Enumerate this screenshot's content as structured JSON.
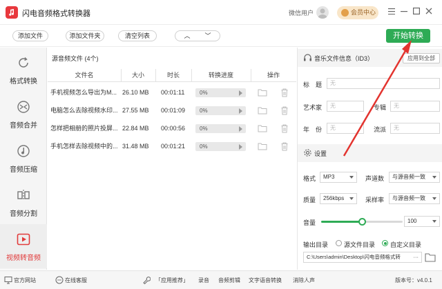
{
  "app": {
    "title": "闪电音频格式转换器"
  },
  "user": {
    "label": "微信用户",
    "vip_label": "会员中心"
  },
  "toolbar": {
    "add_file": "添加文件",
    "add_folder": "添加文件夹",
    "clear_list": "清空列表",
    "move_up": "︿",
    "move_down": "﹀",
    "start": "开始转换"
  },
  "sidebar": {
    "items": [
      {
        "label": "格式转换",
        "icon": "refresh-icon"
      },
      {
        "label": "音频合并",
        "icon": "merge-icon"
      },
      {
        "label": "音频压缩",
        "icon": "compress-icon"
      },
      {
        "label": "音频分割",
        "icon": "split-icon"
      },
      {
        "label": "视频转音频",
        "icon": "video-icon",
        "active": true
      }
    ]
  },
  "filelist": {
    "header": "源音频文件 (4个)",
    "columns": {
      "name": "文件名",
      "size": "大小",
      "duration": "时长",
      "progress": "转换进度",
      "ops": "操作"
    },
    "rows": [
      {
        "name": "手机视频怎么导出为M...",
        "size": "26.10 MB",
        "duration": "00:01:11",
        "progress_text": "0%",
        "progress": 0
      },
      {
        "name": "电脑怎么去除视频水印...",
        "size": "27.55 MB",
        "duration": "00:01:09",
        "progress_text": "0%",
        "progress": 0
      },
      {
        "name": "怎样把相册的照片投屏...",
        "size": "22.84 MB",
        "duration": "00:00:56",
        "progress_text": "0%",
        "progress": 0
      },
      {
        "name": "手机怎样去除视频中的...",
        "size": "31.48 MB",
        "duration": "00:01:21",
        "progress_text": "0%",
        "progress": 0
      }
    ]
  },
  "id3": {
    "title": "音乐文件信息（ID3）",
    "apply_all": "应用到全部",
    "fields": {
      "title_label": "标　题",
      "artist_label": "艺术家",
      "album_label": "专辑",
      "year_label": "年　份",
      "genre_label": "流派",
      "placeholder": "无"
    }
  },
  "settings": {
    "title": "设置",
    "format_label": "格式",
    "format_value": "MP3",
    "channels_label": "声道数",
    "channels_value": "与源音频一致",
    "quality_label": "质量",
    "quality_value": "256kbps",
    "samplerate_label": "采样率",
    "samplerate_value": "与源音频一致",
    "volume_label": "音量",
    "volume_value": "100",
    "volume_level": 0.5,
    "output_label": "输出目录",
    "output_source": "源文件目录",
    "output_custom": "自定义目录",
    "output_path": "C:\\Users\\admin\\Desktop\\闪电音频格式转",
    "output_more": "···"
  },
  "statusbar": {
    "website": "官方网站",
    "support": "在线客服",
    "recommend": "「应用推荐」",
    "record": "录音",
    "audio_edit": "音频剪辑",
    "tts": "文字语音转换",
    "vocal_remove": "消除人声",
    "version": "版本号：v4.0.1"
  },
  "colors": {
    "accent": "#2eab55",
    "active_red": "#e13b3b",
    "arrow_red": "#e3342f"
  }
}
